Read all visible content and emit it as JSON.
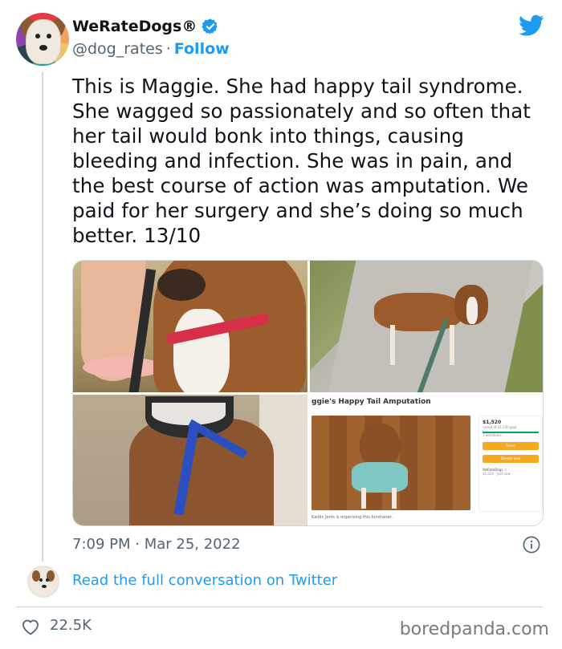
{
  "tweet": {
    "author_name": "WeRateDogs®",
    "handle": "@dog_rates",
    "separator": "·",
    "follow_label": "Follow",
    "text": "This is Maggie. She had happy tail syndrome. She wagged so passionately and so often that her tail would bonk into things, causing bleeding and infection. She was in pain, and the best course of action was amputation. We paid for her surgery and she’s doing so much better. 13/10",
    "timestamp": "7:09 PM · Mar 25, 2022",
    "read_conversation_label": "Read the full conversation on Twitter",
    "likes": "22.5K"
  },
  "media": {
    "fundraiser": {
      "title": "ggie's Happy Tail Amputation",
      "amount": "$1,520",
      "amount_sub": "raised of $1,520 goal",
      "donations": "1 donations",
      "share_label": "Share",
      "donate_label": "Donate now",
      "donor_name": "WeRateDogs :)",
      "donor_sub": "$1,520 · Just now",
      "organizer_caption": "Kaitlin Jenis is organizing this fundraiser."
    }
  },
  "watermark": "boredpanda.com",
  "icons": {
    "verified": "verified-badge-icon",
    "twitter": "twitter-bird-icon",
    "info": "info-icon",
    "like": "heart-icon"
  },
  "colors": {
    "brand_blue": "#1d9bf0",
    "text_primary": "#0f1419",
    "text_secondary": "#536471"
  }
}
